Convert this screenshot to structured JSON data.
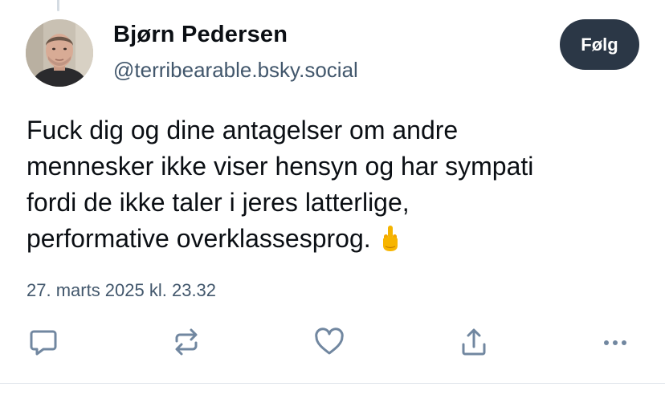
{
  "author": {
    "display_name": "Bjørn Pedersen",
    "handle": "@terribearable.bsky.social",
    "avatar_icon": "profile-photo"
  },
  "follow_button": {
    "label": "Følg",
    "color": "#2b3746"
  },
  "post": {
    "lines": [
      "Fuck dig og dine antagelser om andre",
      "mennesker ikke viser hensyn og har sympati",
      "fordi de ikke taler i jeres latterlige,",
      "performative overklassesprog."
    ],
    "emoji_icon": "middle-finger-emoji"
  },
  "timestamp": "27. marts 2025 kl. 23.32",
  "actions": [
    {
      "name": "reply",
      "icon": "reply-bubble-icon"
    },
    {
      "name": "repost",
      "icon": "repost-icon"
    },
    {
      "name": "like",
      "icon": "heart-icon"
    },
    {
      "name": "share",
      "icon": "share-icon"
    },
    {
      "name": "more",
      "icon": "more-options-icon"
    }
  ],
  "colors": {
    "text": "#0b0f14",
    "secondary_text": "#42576c",
    "icon": "#7187a0"
  }
}
